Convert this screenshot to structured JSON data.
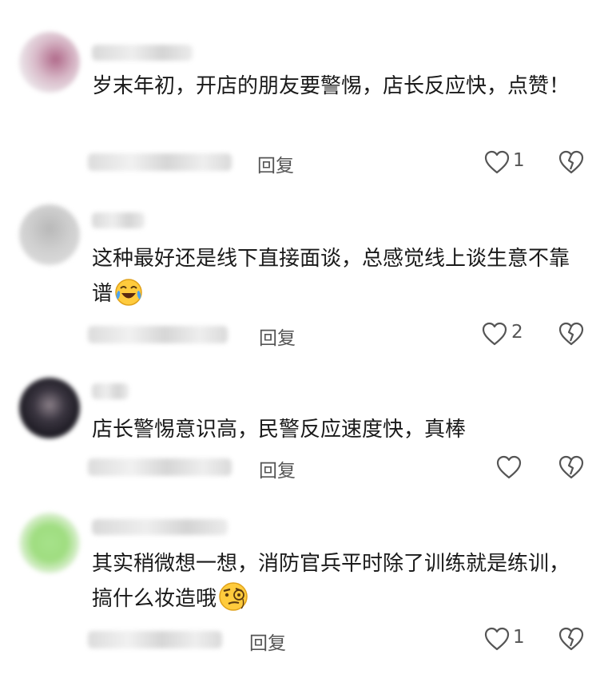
{
  "comments": [
    {
      "text": "岁末年初，开店的朋友要警惕，店长反应快，点赞！",
      "reply": "回复",
      "likes": "1",
      "avatar_color": "#c9a3b5"
    },
    {
      "text": "这种最好还是线下直接面谈，总感觉线上谈生意不靠谱",
      "emoji": "laughing-crying-emoji",
      "reply": "回复",
      "likes": "2",
      "avatar_color": "#d0d0d0"
    },
    {
      "text": "店长警惕意识高，民警反应速度快，真棒",
      "reply": "回复",
      "likes": "",
      "avatar_color": "#3a3540"
    },
    {
      "text": "其实稍微想一想，消防官兵平时除了训练就是练训，搞什么妆造哦",
      "emoji": "skeptical-monocle-emoji",
      "reply": "回复",
      "likes": "1",
      "avatar_color": "#9fdd80"
    }
  ]
}
